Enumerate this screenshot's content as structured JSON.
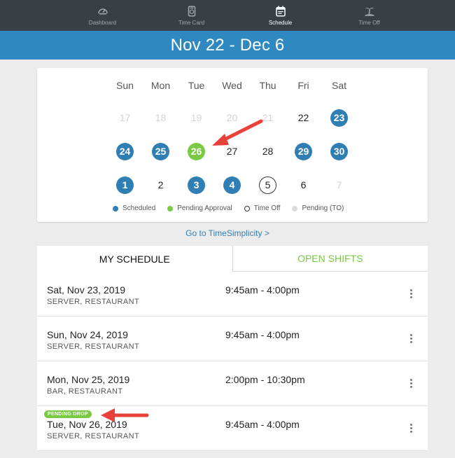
{
  "nav": {
    "items": [
      {
        "label": "Dashboard",
        "icon": "dashboard-icon"
      },
      {
        "label": "Time Card",
        "icon": "time-card-icon"
      },
      {
        "label": "Schedule",
        "icon": "schedule-icon"
      },
      {
        "label": "Time Off",
        "icon": "time-off-icon"
      }
    ],
    "active_label": "Schedule"
  },
  "header": {
    "title": "Nov 22 - Dec 6"
  },
  "calendar": {
    "weekdays": [
      "Sun",
      "Mon",
      "Tue",
      "Wed",
      "Thu",
      "Fri",
      "Sat"
    ],
    "weeks": [
      [
        {
          "d": "17",
          "s": "muted"
        },
        {
          "d": "18",
          "s": "muted"
        },
        {
          "d": "19",
          "s": "muted"
        },
        {
          "d": "20",
          "s": "muted"
        },
        {
          "d": "21",
          "s": "muted"
        },
        {
          "d": "22",
          "s": "normal"
        },
        {
          "d": "23",
          "s": "scheduled"
        }
      ],
      [
        {
          "d": "24",
          "s": "scheduled"
        },
        {
          "d": "25",
          "s": "scheduled"
        },
        {
          "d": "26",
          "s": "pending"
        },
        {
          "d": "27",
          "s": "normal"
        },
        {
          "d": "28",
          "s": "normal"
        },
        {
          "d": "29",
          "s": "scheduled"
        },
        {
          "d": "30",
          "s": "scheduled"
        }
      ],
      [
        {
          "d": "1",
          "s": "scheduled"
        },
        {
          "d": "2",
          "s": "normal"
        },
        {
          "d": "3",
          "s": "scheduled"
        },
        {
          "d": "4",
          "s": "scheduled"
        },
        {
          "d": "5",
          "s": "timeoff"
        },
        {
          "d": "6",
          "s": "normal"
        },
        {
          "d": "7",
          "s": "muted"
        }
      ]
    ],
    "legend": [
      {
        "label": "Scheduled",
        "color": "#2f7fb5",
        "kind": "filled"
      },
      {
        "label": "Pending Approval",
        "color": "#7ac943",
        "kind": "filled"
      },
      {
        "label": "Time Off",
        "color": "#333333",
        "kind": "outline"
      },
      {
        "label": "Pending (TO)",
        "color": "#dcdcdc",
        "kind": "filled"
      }
    ]
  },
  "goto_link": "Go to TimeSimplicity >",
  "tabs": {
    "my_schedule": "MY SCHEDULE",
    "open_shifts": "OPEN SHIFTS"
  },
  "shifts": [
    {
      "date": "Sat, Nov 23, 2019",
      "role": "SERVER, RESTAURANT",
      "time": "9:45am - 4:00pm",
      "badge": ""
    },
    {
      "date": "Sun, Nov 24, 2019",
      "role": "SERVER, RESTAURANT",
      "time": "9:45am - 4:00pm",
      "badge": ""
    },
    {
      "date": "Mon, Nov 25, 2019",
      "role": "BAR, RESTAURANT",
      "time": "2:00pm - 10:30pm",
      "badge": ""
    },
    {
      "date": "Tue, Nov 26, 2019",
      "role": "SERVER, RESTAURANT",
      "time": "9:45am - 4:00pm",
      "badge": "PENDING DROP"
    }
  ],
  "colors": {
    "brand": "#2f88c0",
    "scheduled": "#2f7fb5",
    "pending": "#7ac943",
    "annotation_arrow": "#e8413b"
  }
}
